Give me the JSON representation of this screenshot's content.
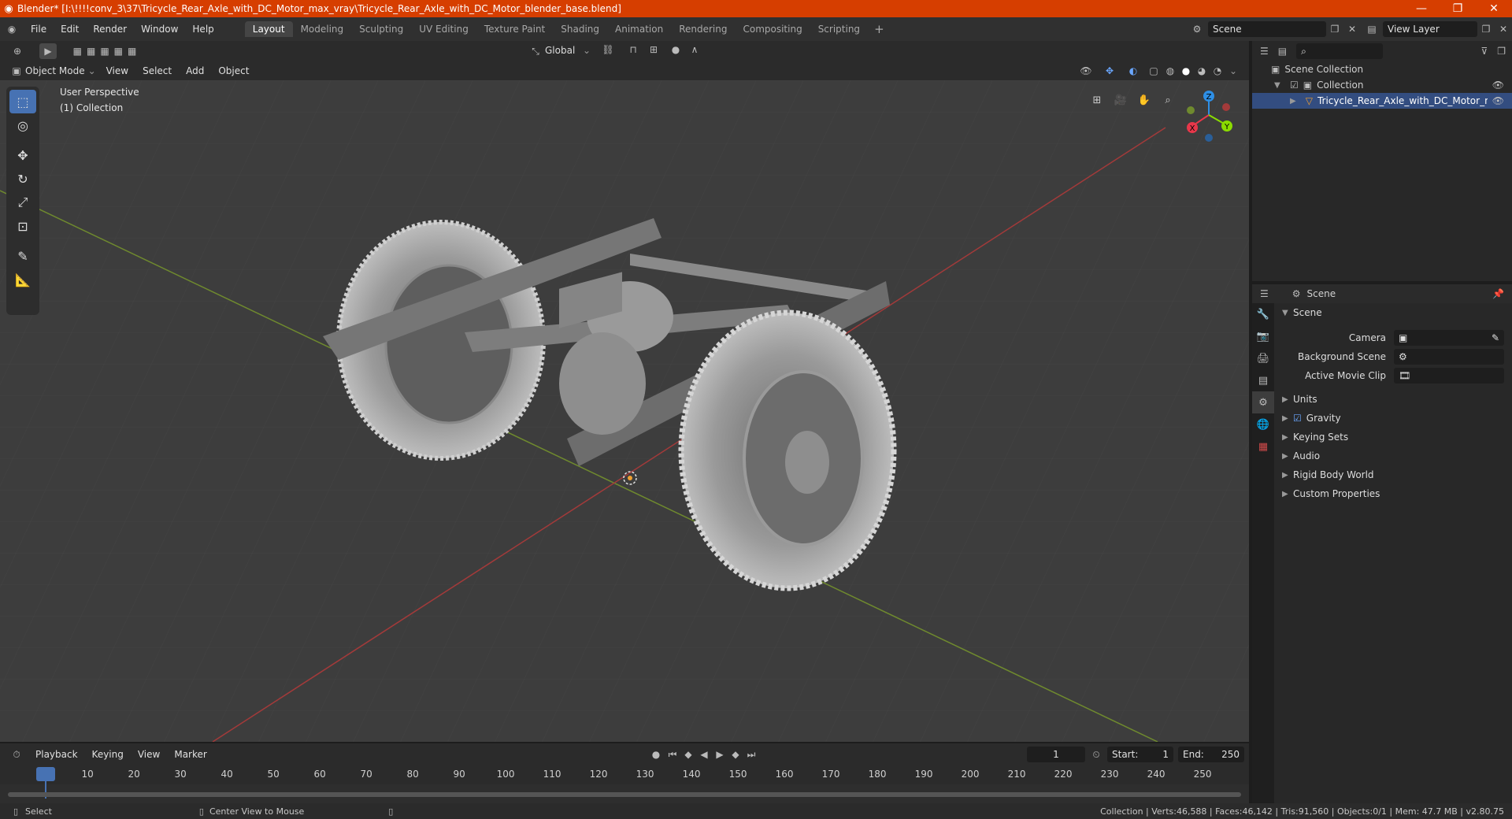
{
  "title": "Blender* [I:\\!!!!conv_3\\37\\Tricycle_Rear_Axle_with_DC_Motor_max_vray\\Tricycle_Rear_Axle_with_DC_Motor_blender_base.blend]",
  "menus": [
    "File",
    "Edit",
    "Render",
    "Window",
    "Help"
  ],
  "workspaces": [
    "Layout",
    "Modeling",
    "Sculpting",
    "UV Editing",
    "Texture Paint",
    "Shading",
    "Animation",
    "Rendering",
    "Compositing",
    "Scripting"
  ],
  "active_workspace": "Layout",
  "scene_name": "Scene",
  "view_layer": "View Layer",
  "viewport": {
    "transform_orientation": "Global",
    "mode": "Object Mode",
    "header_menus": [
      "View",
      "Select",
      "Add",
      "Object"
    ],
    "overlay_line1": "User Perspective",
    "overlay_line2": "(1) Collection",
    "gizmo_axes": {
      "x": "X",
      "y": "Y",
      "z": "Z"
    }
  },
  "outliner": {
    "root": "Scene Collection",
    "collection": "Collection",
    "object": "Tricycle_Rear_Axle_with_DC_Motor_max_co"
  },
  "properties": {
    "header": "Scene",
    "panel": "Scene",
    "fields": [
      {
        "label": "Camera"
      },
      {
        "label": "Background Scene"
      },
      {
        "label": "Active Movie Clip"
      }
    ],
    "sections": [
      "Units",
      "Gravity",
      "Keying Sets",
      "Audio",
      "Rigid Body World",
      "Custom Properties"
    ]
  },
  "timeline": {
    "menus": [
      "Playback",
      "Keying",
      "View",
      "Marker"
    ],
    "current_frame": "1",
    "start_label": "Start:",
    "start": "1",
    "end_label": "End:",
    "end": "250",
    "ticks": [
      "1",
      "10",
      "20",
      "30",
      "40",
      "50",
      "60",
      "70",
      "80",
      "90",
      "100",
      "110",
      "120",
      "130",
      "140",
      "150",
      "160",
      "170",
      "180",
      "190",
      "200",
      "210",
      "220",
      "230",
      "240",
      "250"
    ]
  },
  "status": {
    "left1": "Select",
    "left2": "Center View to Mouse",
    "right": "Collection | Verts:46,588 | Faces:46,142 | Tris:91,560 | Objects:0/1 | Mem: 47.7 MB | v2.80.75"
  },
  "colors": {
    "accent": "#4772b3",
    "titlebar": "#d63e00",
    "x_axis": "#e8374a",
    "y_axis": "#8bdc00",
    "z_axis": "#2e8fe6"
  }
}
